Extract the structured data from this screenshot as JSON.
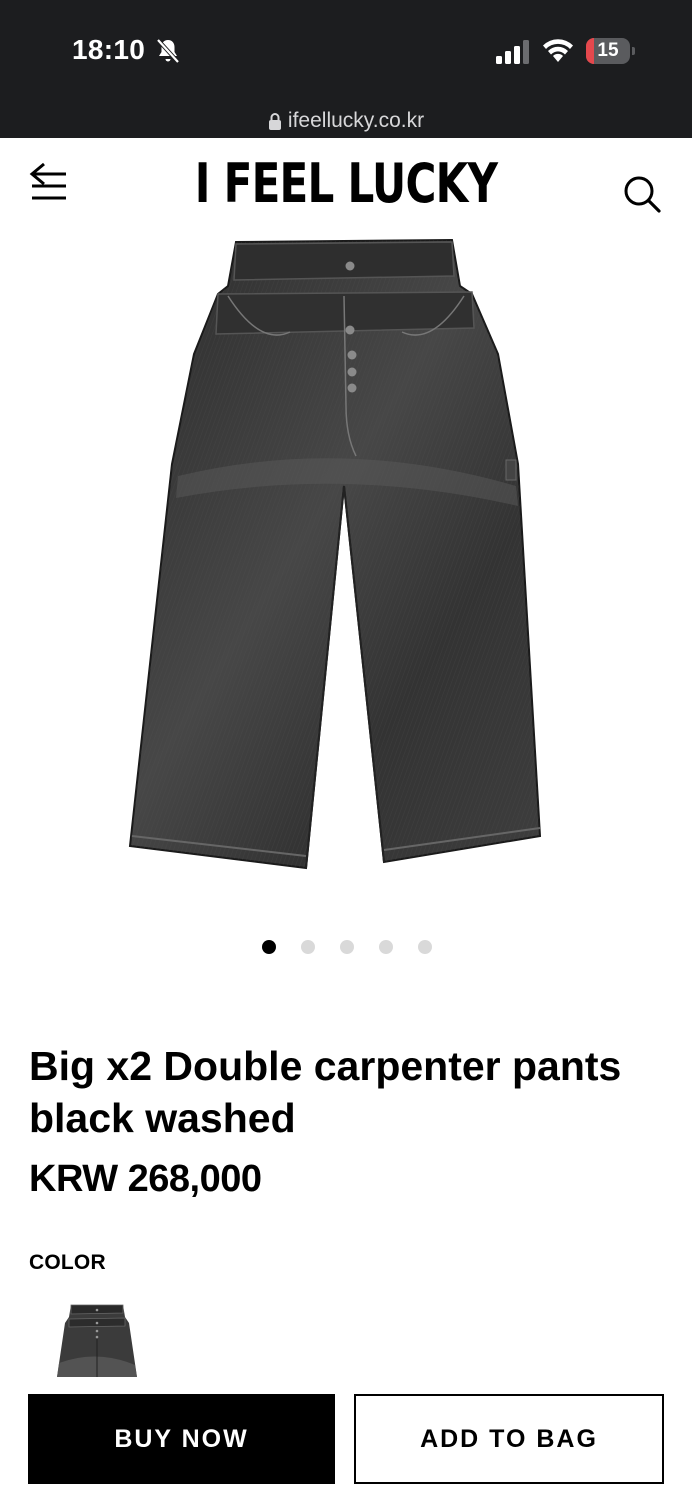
{
  "status_bar": {
    "time": "18:10",
    "battery_level": "15",
    "icons": [
      "bell-slash-icon",
      "cellular-signal-icon",
      "wifi-icon",
      "battery-icon"
    ]
  },
  "browser": {
    "url": "ifeellucky.co.kr",
    "icons": [
      "lock-icon"
    ]
  },
  "header": {
    "logo": "I FEEL LUCKY",
    "icons": [
      "menu-back-icon",
      "search-icon"
    ]
  },
  "gallery": {
    "slide_count": 5,
    "active_slide": 1
  },
  "product": {
    "title": "Big x2 Double carpenter pants black washed",
    "price": "KRW 268,000",
    "color_label": "COLOR"
  },
  "actions": {
    "buy_now": "BUY NOW",
    "add_to_bag": "ADD TO BAG"
  },
  "colors": {
    "status_bar_bg": "#1c1d1f",
    "battery_low": "#e5484d",
    "denim": "#3a3a3a",
    "dot_inactive": "#d9d9d9"
  }
}
